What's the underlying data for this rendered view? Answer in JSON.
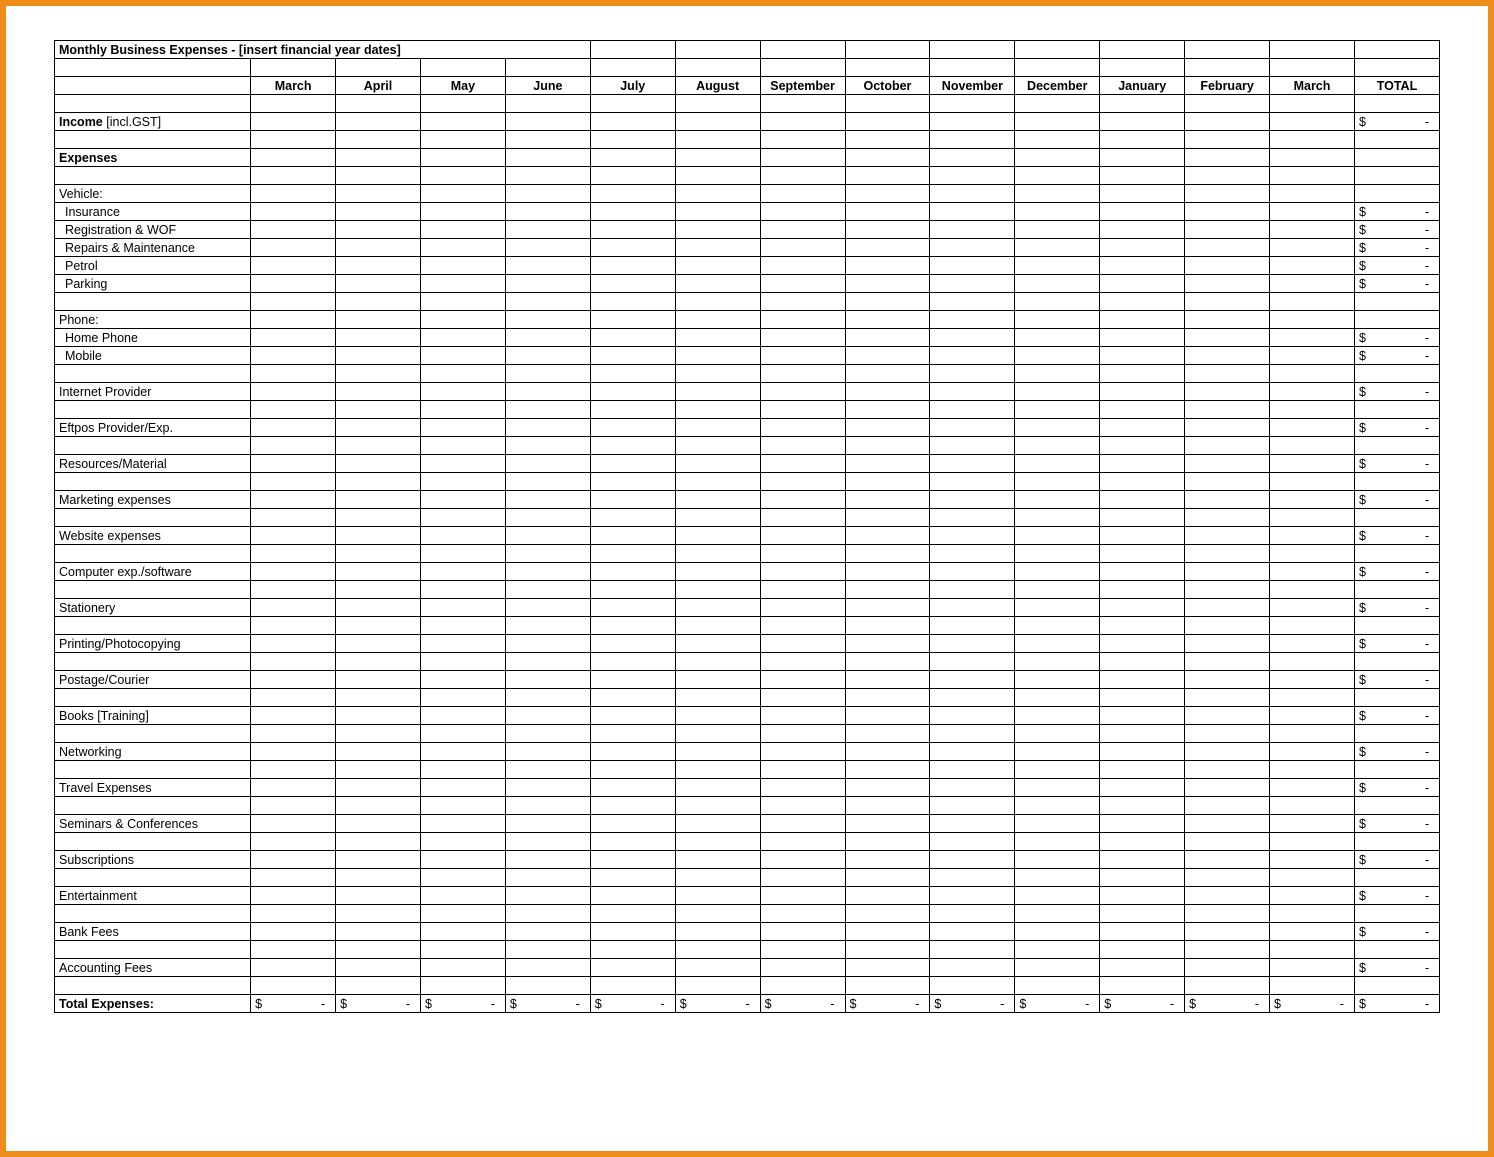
{
  "title": "Monthly Business Expenses - [insert financial year dates]",
  "months": [
    "March",
    "April",
    "May",
    "June",
    "July",
    "August",
    "September",
    "October",
    "November",
    "December",
    "January",
    "February",
    "March"
  ],
  "total_header": "TOTAL",
  "income_label": "Income",
  "income_suffix": " [incl.GST]",
  "expenses_label": "Expenses",
  "currency_symbol": "$",
  "dash": "-",
  "sections": [
    {
      "type": "sec",
      "label": "Vehicle:"
    },
    {
      "type": "item",
      "label": "Insurance",
      "indent": true,
      "total": true
    },
    {
      "type": "item",
      "label": "Registration & WOF",
      "indent": true,
      "total": true
    },
    {
      "type": "item",
      "label": "Repairs & Maintenance",
      "indent": true,
      "total": true
    },
    {
      "type": "item",
      "label": "Petrol",
      "indent": true,
      "total": true
    },
    {
      "type": "item",
      "label": "Parking",
      "indent": true,
      "total": true
    },
    {
      "type": "blank"
    },
    {
      "type": "sec",
      "label": "Phone:"
    },
    {
      "type": "item",
      "label": "Home Phone",
      "indent": true,
      "total": true
    },
    {
      "type": "item",
      "label": "Mobile",
      "indent": true,
      "total": true
    },
    {
      "type": "blank"
    },
    {
      "type": "item",
      "label": "Internet Provider",
      "total": true
    },
    {
      "type": "blank"
    },
    {
      "type": "item",
      "label": "Eftpos Provider/Exp.",
      "total": true
    },
    {
      "type": "blank"
    },
    {
      "type": "item",
      "label": "Resources/Material",
      "total": true
    },
    {
      "type": "blank"
    },
    {
      "type": "item",
      "label": "Marketing expenses",
      "total": true
    },
    {
      "type": "blank"
    },
    {
      "type": "item",
      "label": "Website expenses",
      "total": true
    },
    {
      "type": "blank"
    },
    {
      "type": "item",
      "label": "Computer exp./software",
      "total": true
    },
    {
      "type": "blank"
    },
    {
      "type": "item",
      "label": "Stationery",
      "total": true
    },
    {
      "type": "blank"
    },
    {
      "type": "item",
      "label": "Printing/Photocopying",
      "total": true
    },
    {
      "type": "blank"
    },
    {
      "type": "item",
      "label": "Postage/Courier",
      "total": true
    },
    {
      "type": "blank"
    },
    {
      "type": "item",
      "label": "Books [Training]",
      "total": true
    },
    {
      "type": "blank"
    },
    {
      "type": "item",
      "label": "Networking",
      "total": true
    },
    {
      "type": "blank"
    },
    {
      "type": "item",
      "label": "Travel Expenses",
      "total": true
    },
    {
      "type": "blank"
    },
    {
      "type": "item",
      "label": "Seminars & Conferences",
      "total": true
    },
    {
      "type": "blank"
    },
    {
      "type": "item",
      "label": "Subscriptions",
      "total": true
    },
    {
      "type": "blank"
    },
    {
      "type": "item",
      "label": "Entertainment",
      "total": true
    },
    {
      "type": "blank"
    },
    {
      "type": "item",
      "label": "Bank Fees",
      "total": true
    },
    {
      "type": "blank"
    },
    {
      "type": "item",
      "label": "Accounting Fees",
      "total": true
    },
    {
      "type": "blank"
    }
  ],
  "total_expenses_label": "Total Expenses:"
}
